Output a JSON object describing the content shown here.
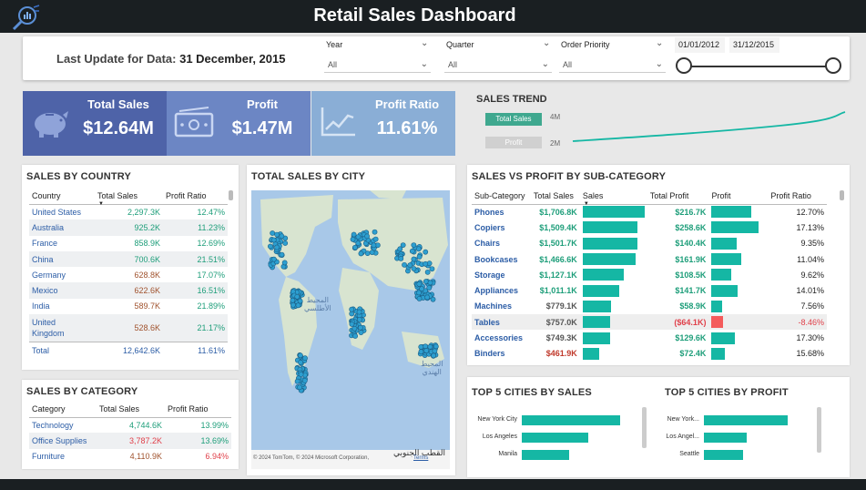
{
  "header": {
    "title": "Retail Sales Dashboard",
    "logo_icon": "analytics-logo-icon"
  },
  "filters": {
    "last_update_label": "Last Update for Data:",
    "last_update_value": "31 December, 2015",
    "year": {
      "label": "Year",
      "value": "All"
    },
    "quarter": {
      "label": "Quarter",
      "value": "All"
    },
    "order_priority": {
      "label": "Order Priority",
      "value": "All"
    },
    "date_start": "01/01/2012",
    "date_end": "31/12/2015"
  },
  "kpis": {
    "total_sales": {
      "label": "Total Sales",
      "value": "$12.64M",
      "icon": "piggy-bank-icon",
      "color": "#4e63a8"
    },
    "profit": {
      "label": "Profit",
      "value": "$1.47M",
      "icon": "cash-icon",
      "color": "#6c86c4"
    },
    "profit_ratio": {
      "label": "Profit Ratio",
      "value": "11.61%",
      "icon": "line-chart-icon",
      "color": "#8aaed6"
    }
  },
  "sales_trend": {
    "title": "SALES TREND",
    "legend_sales": "Total Sales",
    "legend_profit": "Profit",
    "y_top": "4M",
    "y_bottom": "2M"
  },
  "sales_by_country": {
    "title": "SALES BY COUNTRY",
    "headers": [
      "Country",
      "Total Sales",
      "Profit Ratio"
    ],
    "rows": [
      {
        "country": "United States",
        "sales": "2,297.3K",
        "ratio": "12.47%"
      },
      {
        "country": "Australia",
        "sales": "925.2K",
        "ratio": "11.23%"
      },
      {
        "country": "France",
        "sales": "858.9K",
        "ratio": "12.69%"
      },
      {
        "country": "China",
        "sales": "700.6K",
        "ratio": "21.51%"
      },
      {
        "country": "Germany",
        "sales": "628.8K",
        "ratio": "17.07%"
      },
      {
        "country": "Mexico",
        "sales": "622.6K",
        "ratio": "16.51%"
      },
      {
        "country": "India",
        "sales": "589.7K",
        "ratio": "21.89%"
      },
      {
        "country": "United",
        "country2": "Kingdom",
        "sales": "528.6K",
        "ratio": "21.17%"
      }
    ],
    "total": {
      "label": "Total",
      "sales": "12,642.6K",
      "ratio": "11.61%"
    }
  },
  "sales_by_category": {
    "title": "SALES BY CATEGORY",
    "headers": [
      "Category",
      "Total Sales",
      "Profit Ratio"
    ],
    "rows": [
      {
        "category": "Technology",
        "sales": "4,744.6K",
        "ratio": "13.99%"
      },
      {
        "category": "Office Supplies",
        "sales": "3,787.2K",
        "ratio": "13.69%"
      },
      {
        "category": "Furniture",
        "sales": "4,110.9K",
        "ratio": "6.94%"
      }
    ]
  },
  "city_map": {
    "title": "TOTAL SALES BY CITY",
    "label_atlantic_1": "المحيط",
    "label_atlantic_2": "الأطلسي",
    "label_indian_1": "المحيط",
    "label_indian_2": "الهندي",
    "label_antarctica": "القطب الجنوبي",
    "copyright": "© 2024 TomTom, © 2024 Microsoft Corporation,",
    "terms": "Terms"
  },
  "subcategory": {
    "title": "SALES VS PROFIT BY SUB-CATEGORY",
    "headers": [
      "Sub-Category",
      "Total Sales",
      "Sales",
      "Total Profit",
      "Profit",
      "Profit Ratio"
    ],
    "rows": [
      {
        "name": "Phones",
        "sales": "$1,706.8K",
        "sales_frac": 1.0,
        "profit": "$216.7K",
        "profit_frac": 0.84,
        "ratio": "12.70%"
      },
      {
        "name": "Copiers",
        "sales": "$1,509.4K",
        "sales_frac": 0.88,
        "profit": "$258.6K",
        "profit_frac": 1.0,
        "ratio": "17.13%"
      },
      {
        "name": "Chairs",
        "sales": "$1,501.7K",
        "sales_frac": 0.88,
        "profit": "$140.4K",
        "profit_frac": 0.54,
        "ratio": "9.35%"
      },
      {
        "name": "Bookcases",
        "sales": "$1,466.6K",
        "sales_frac": 0.86,
        "profit": "$161.9K",
        "profit_frac": 0.63,
        "ratio": "11.04%"
      },
      {
        "name": "Storage",
        "sales": "$1,127.1K",
        "sales_frac": 0.66,
        "profit": "$108.5K",
        "profit_frac": 0.42,
        "ratio": "9.62%"
      },
      {
        "name": "Appliances",
        "sales": "$1,011.1K",
        "sales_frac": 0.59,
        "profit": "$141.7K",
        "profit_frac": 0.55,
        "ratio": "14.01%"
      },
      {
        "name": "Machines",
        "sales": "$779.1K",
        "sales_frac": 0.46,
        "profit": "$58.9K",
        "profit_frac": 0.23,
        "ratio": "7.56%"
      },
      {
        "name": "Tables",
        "sales": "$757.0K",
        "sales_frac": 0.44,
        "profit": "($64.1K)",
        "profit_frac": -0.25,
        "ratio": "-8.46%"
      },
      {
        "name": "Accessories",
        "sales": "$749.3K",
        "sales_frac": 0.44,
        "profit": "$129.6K",
        "profit_frac": 0.5,
        "ratio": "17.30%"
      },
      {
        "name": "Binders",
        "sales": "$461.9K",
        "sales_frac": 0.27,
        "profit": "$72.4K",
        "profit_frac": 0.28,
        "ratio": "15.68%"
      }
    ]
  },
  "top5_sales": {
    "title": "TOP 5 CITIES BY SALES",
    "rows": [
      {
        "city": "New York City",
        "frac": 1.0
      },
      {
        "city": "Los Angeles",
        "frac": 0.68
      },
      {
        "city": "Manila",
        "frac": 0.48
      }
    ]
  },
  "top5_profit": {
    "title": "TOP 5 CITIES BY PROFIT",
    "rows": [
      {
        "city": "New York...",
        "frac": 1.0
      },
      {
        "city": "Los Angel...",
        "frac": 0.51
      },
      {
        "city": "Seattle",
        "frac": 0.47
      }
    ]
  },
  "colors": {
    "teal": "#15b7a4",
    "negative": "#f45b5b",
    "header_bg": "#1a1f22"
  }
}
